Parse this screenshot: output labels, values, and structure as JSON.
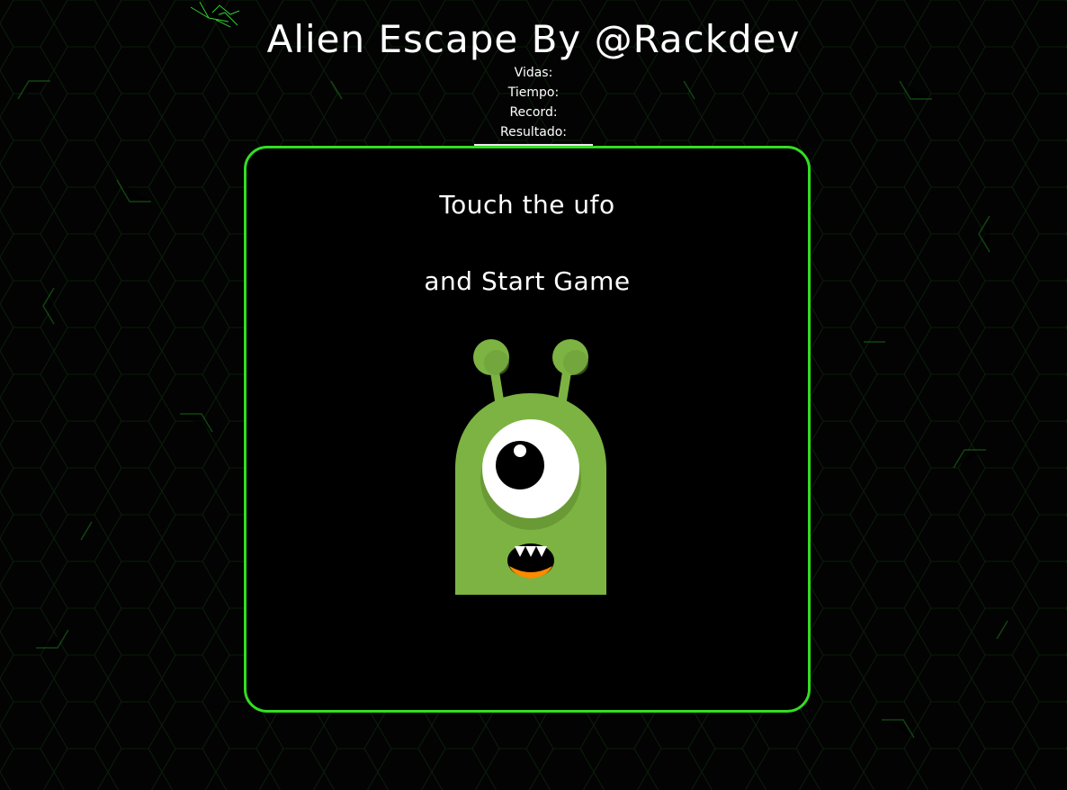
{
  "game": {
    "title": "Alien Escape By @Rackdev",
    "stats": {
      "lives_label": "Vidas:",
      "time_label": "Tiempo:",
      "record_label": "Record:",
      "result_label": "Resultado:"
    },
    "instructions": {
      "line1": "Touch the ufo",
      "line2": "and Start Game"
    }
  },
  "colors": {
    "accent_border": "#33dd22",
    "alien_body": "#7cb342",
    "alien_shadow": "#6a9a36",
    "mouth_tongue": "#ff8a00"
  },
  "icons": {
    "ufo": "one-eyed-green-alien"
  }
}
